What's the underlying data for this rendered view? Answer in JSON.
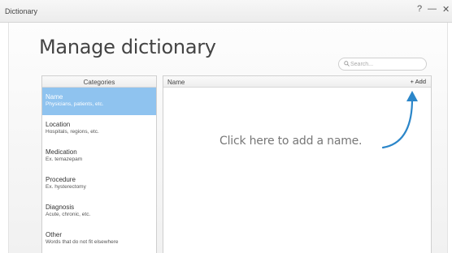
{
  "window": {
    "title": "Dictionary",
    "help_glyph": "?",
    "minimize_glyph": "—",
    "close_glyph": "✕"
  },
  "page": {
    "heading": "Manage dictionary"
  },
  "search": {
    "placeholder": "Search..."
  },
  "categories": {
    "header": "Categories",
    "items": [
      {
        "name": "Name",
        "description": "Physicians, patients, etc.",
        "selected": true
      },
      {
        "name": "Location",
        "description": "Hospitals, regions, etc."
      },
      {
        "name": "Medication",
        "description": "Ex. temazepam"
      },
      {
        "name": "Procedure",
        "description": "Ex. hysterectomy"
      },
      {
        "name": "Diagnosis",
        "description": "Acute, chronic, etc."
      },
      {
        "name": "Other",
        "description": "Words that do not fit elsewhere"
      }
    ]
  },
  "names": {
    "header": "Name",
    "add_label": "+ Add",
    "hint": "Click here to add a name."
  },
  "colors": {
    "selected_bg": "#8fc3ef",
    "arrow": "#2b86c9"
  },
  "icons": {
    "search": "magnifier-icon",
    "arrow": "curved-arrow-icon"
  }
}
